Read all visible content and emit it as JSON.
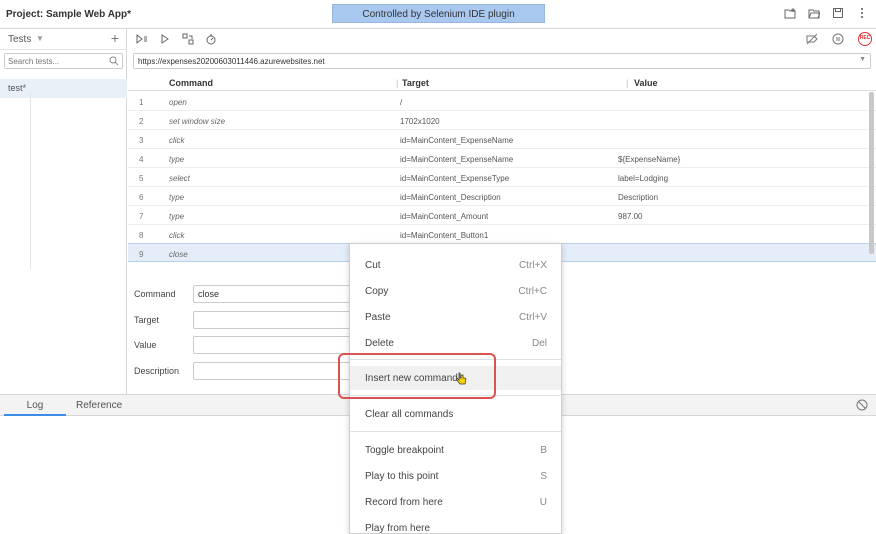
{
  "header": {
    "project_label": "Project:",
    "project_name": "Sample Web App*",
    "banner": "Controlled by Selenium IDE plugin"
  },
  "sidebar": {
    "tests_label": "Tests",
    "add_label": "+",
    "search_placeholder": "Search tests...",
    "test_item": "test*"
  },
  "toolbar": {
    "rec_label": "REC"
  },
  "url": {
    "value": "https://expenses20200603011446.azurewebsites.net"
  },
  "table": {
    "headers": {
      "command": "Command",
      "target": "Target",
      "value": "Value"
    },
    "rows": [
      {
        "num": "1",
        "command": "open",
        "target": "/",
        "value": ""
      },
      {
        "num": "2",
        "command": "set window size",
        "target": "1702x1020",
        "value": ""
      },
      {
        "num": "3",
        "command": "click",
        "target": "id=MainContent_ExpenseName",
        "value": ""
      },
      {
        "num": "4",
        "command": "type",
        "target": "id=MainContent_ExpenseName",
        "value": "${ExpenseName}"
      },
      {
        "num": "5",
        "command": "select",
        "target": "id=MainContent_ExpenseType",
        "value": "label=Lodging"
      },
      {
        "num": "6",
        "command": "type",
        "target": "id=MainContent_Description",
        "value": "Description"
      },
      {
        "num": "7",
        "command": "type",
        "target": "id=MainContent_Amount",
        "value": "987.00"
      },
      {
        "num": "8",
        "command": "click",
        "target": "id=MainContent_Button1",
        "value": ""
      },
      {
        "num": "9",
        "command": "close",
        "target": "",
        "value": ""
      }
    ]
  },
  "editor": {
    "command_label": "Command",
    "command_value": "close",
    "target_label": "Target",
    "value_label": "Value",
    "description_label": "Description"
  },
  "bottom": {
    "log_tab": "Log",
    "reference_tab": "Reference"
  },
  "context_menu": {
    "cut": "Cut",
    "cut_shortcut": "Ctrl+X",
    "copy": "Copy",
    "copy_shortcut": "Ctrl+C",
    "paste": "Paste",
    "paste_shortcut": "Ctrl+V",
    "delete": "Delete",
    "delete_shortcut": "Del",
    "insert": "Insert new command",
    "clear": "Clear all commands",
    "toggle_breakpoint": "Toggle breakpoint",
    "toggle_shortcut": "B",
    "play_to": "Play to this point",
    "play_to_shortcut": "S",
    "record_from": "Record from here",
    "record_shortcut": "U",
    "play_from": "Play from here"
  },
  "colors": {
    "banner_bg": "#a8c8f0",
    "selected_row": "#e4edf8",
    "rec_red": "#e03030",
    "highlight_red": "#d9534f",
    "tab_accent": "#3a8ee6"
  }
}
